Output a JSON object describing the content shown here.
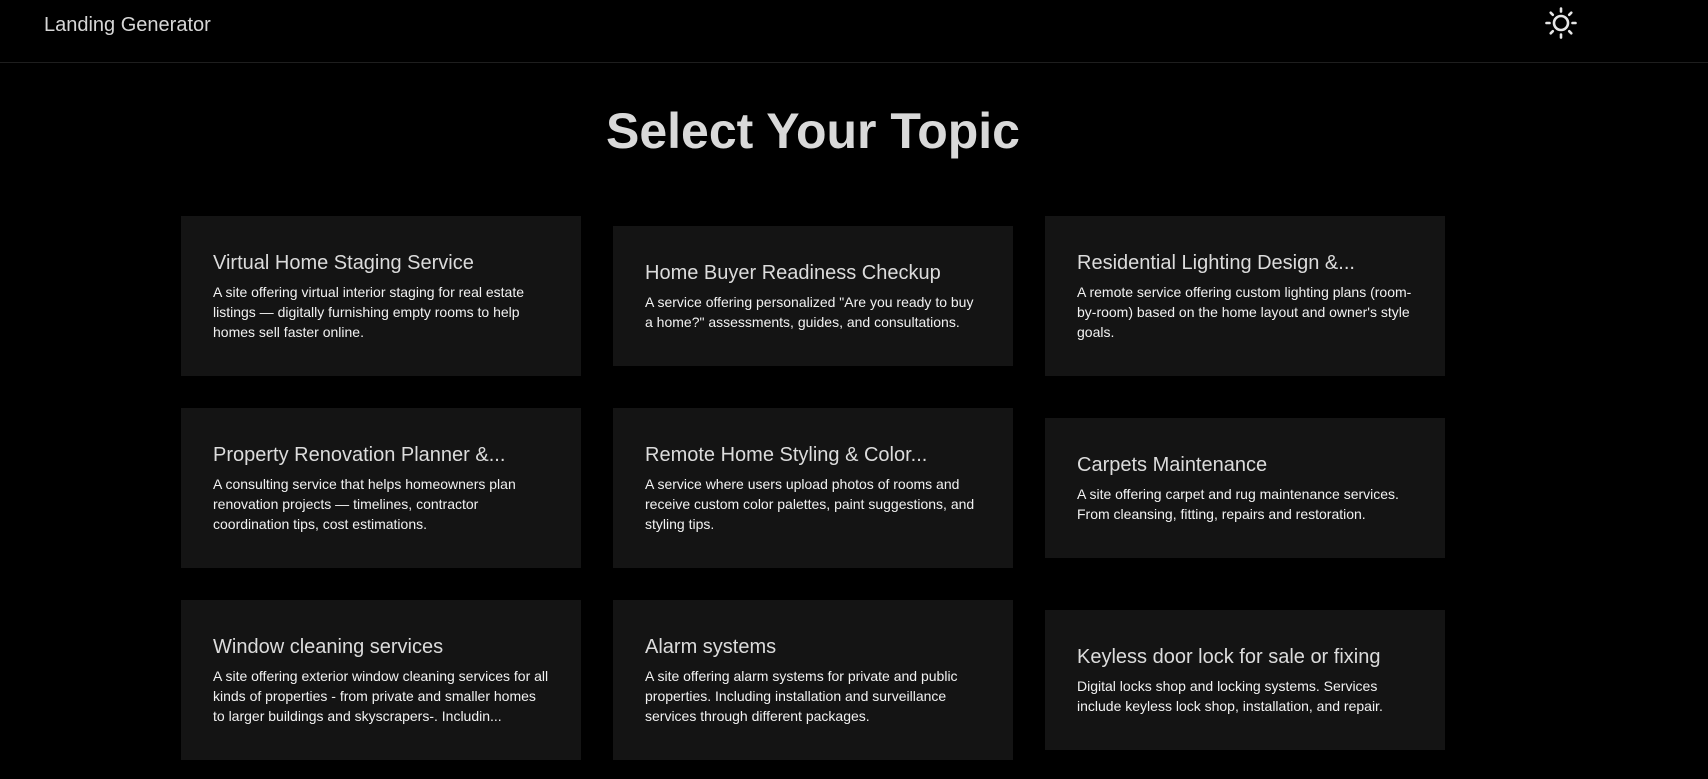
{
  "header": {
    "brand": "Landing Generator",
    "theme_toggle_icon": "sun-icon"
  },
  "main": {
    "title": "Select Your Topic",
    "cards": [
      {
        "title": "Virtual Home Staging Service",
        "description": "A site offering virtual interior staging for real estate listings — digitally furnishing empty rooms to help homes sell faster online."
      },
      {
        "title": "Home Buyer Readiness Checkup",
        "description": "A service offering personalized \"Are you ready to buy a home?\" assessments, guides, and consultations."
      },
      {
        "title": "Residential Lighting Design &...",
        "description": "A remote service offering custom lighting plans (room-by-room) based on the home layout and owner's style goals."
      },
      {
        "title": "Property Renovation Planner &...",
        "description": "A consulting service that helps homeowners plan renovation projects — timelines, contractor coordination tips, cost estimations."
      },
      {
        "title": "Remote Home Styling & Color...",
        "description": "A service where users upload photos of rooms and receive custom color palettes, paint suggestions, and styling tips."
      },
      {
        "title": "Carpets Maintenance",
        "description": "A site offering carpet and rug maintenance services. From cleansing, fitting, repairs and restoration."
      },
      {
        "title": "Window cleaning services",
        "description": "A site offering exterior window cleaning services for all kinds of properties - from private and smaller homes to larger buildings and skyscrapers-. Includin..."
      },
      {
        "title": "Alarm systems",
        "description": "A site offering alarm systems for private and public properties. Including installation and surveillance services through different packages."
      },
      {
        "title": "Keyless door lock for sale or fixing",
        "description": "Digital locks shop and locking systems. Services include keyless lock shop, installation, and repair."
      }
    ]
  }
}
